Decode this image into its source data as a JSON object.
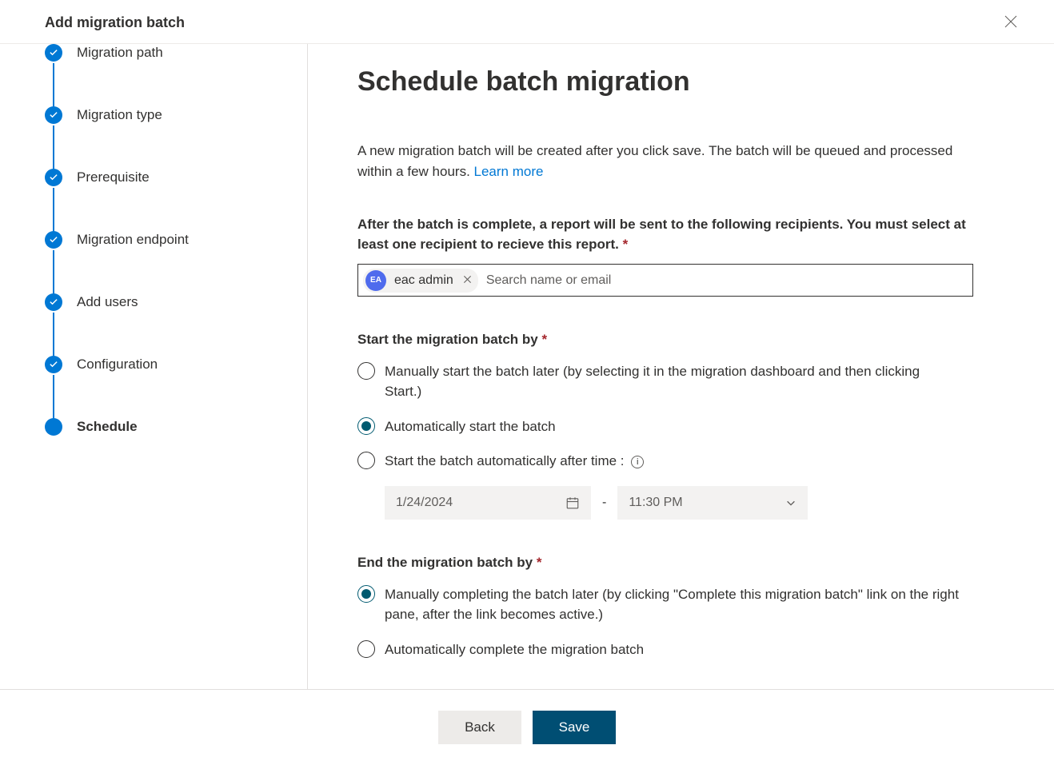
{
  "header": {
    "title": "Add migration batch"
  },
  "steps": [
    {
      "label": "Migration path",
      "completed": true
    },
    {
      "label": "Migration type",
      "completed": true
    },
    {
      "label": "Prerequisite",
      "completed": true
    },
    {
      "label": "Migration endpoint",
      "completed": true
    },
    {
      "label": "Add users",
      "completed": true
    },
    {
      "label": "Configuration",
      "completed": true
    },
    {
      "label": "Schedule",
      "current": true
    }
  ],
  "main": {
    "title": "Schedule batch migration",
    "description_text": "A new migration batch will be created after you click save. The batch will be queued and processed within a few hours. ",
    "learn_more": "Learn more",
    "recipients_label": "After the batch is complete, a report will be sent to the following recipients. You must select at least one recipient to recieve this report.",
    "recipient_chip": {
      "initials": "EA",
      "name": "eac admin"
    },
    "recipient_placeholder": "Search name or email",
    "start_section": {
      "label": "Start the migration batch by",
      "options": [
        "Manually start the batch later (by selecting it in the migration dashboard and then clicking Start.)",
        "Automatically start the batch",
        "Start the batch automatically after time :"
      ],
      "selected_index": 1,
      "date": "1/24/2024",
      "time": "11:30 PM"
    },
    "end_section": {
      "label": "End the migration batch by",
      "options": [
        "Manually completing the batch later (by clicking \"Complete this migration batch\" link on the right pane, after the link becomes active.)",
        "Automatically complete the migration batch"
      ],
      "selected_index": 0
    }
  },
  "footer": {
    "back": "Back",
    "save": "Save"
  }
}
